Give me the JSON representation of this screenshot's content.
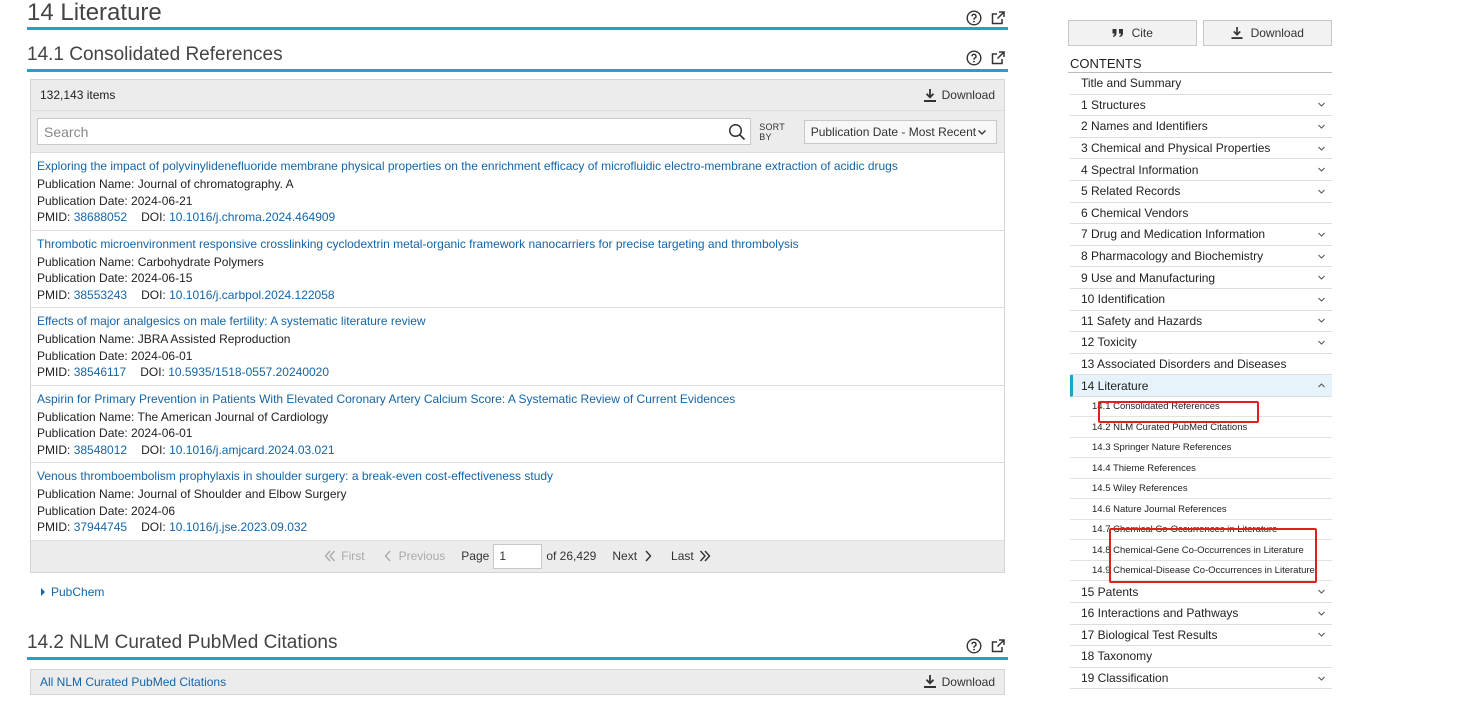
{
  "section": {
    "title": "14 Literature"
  },
  "consolidated": {
    "title": "14.1 Consolidated References",
    "count": "132,143 items",
    "download_label": "Download",
    "search_placeholder": "Search",
    "sort_label": "SORT BY",
    "sort_value": "Publication Date - Most Recent",
    "items": [
      {
        "title": "Exploring the impact of polyvinylidenefluoride membrane physical properties on the enrichment efficacy of microfluidic electro-membrane extraction of acidic drugs",
        "pub_name": "Publication Name: Journal of chromatography. A",
        "pub_date": "Publication Date: 2024-06-21",
        "pmid_label": "PMID:",
        "pmid": "38688052",
        "doi_label": "DOI:",
        "doi": "10.1016/j.chroma.2024.464909"
      },
      {
        "title": "Thrombotic microenvironment responsive crosslinking cyclodextrin metal-organic framework nanocarriers for precise targeting and thrombolysis",
        "pub_name": "Publication Name: Carbohydrate Polymers",
        "pub_date": "Publication Date: 2024-06-15",
        "pmid_label": "PMID:",
        "pmid": "38553243",
        "doi_label": "DOI:",
        "doi": "10.1016/j.carbpol.2024.122058"
      },
      {
        "title": "Effects of major analgesics on male fertility: A systematic literature review",
        "pub_name": "Publication Name: JBRA Assisted Reproduction",
        "pub_date": "Publication Date: 2024-06-01",
        "pmid_label": "PMID:",
        "pmid": "38546117",
        "doi_label": "DOI:",
        "doi": "10.5935/1518-0557.20240020"
      },
      {
        "title": "Aspirin for Primary Prevention in Patients With Elevated Coronary Artery Calcium Score: A Systematic Review of Current Evidences",
        "pub_name": "Publication Name: The American Journal of Cardiology",
        "pub_date": "Publication Date: 2024-06-01",
        "pmid_label": "PMID:",
        "pmid": "38548012",
        "doi_label": "DOI:",
        "doi": "10.1016/j.amjcard.2024.03.021"
      },
      {
        "title": "Venous thromboembolism prophylaxis in shoulder surgery: a break-even cost-effectiveness study",
        "pub_name": "Publication Name: Journal of Shoulder and Elbow Surgery",
        "pub_date": "Publication Date: 2024-06",
        "pmid_label": "PMID:",
        "pmid": "37944745",
        "doi_label": "DOI:",
        "doi": "10.1016/j.jse.2023.09.032"
      }
    ],
    "pager": {
      "first": "First",
      "previous": "Previous",
      "page_label": "Page",
      "page_value": "1",
      "of_total": "of 26,429",
      "next": "Next",
      "last": "Last"
    },
    "source_link": "PubChem"
  },
  "nlm": {
    "title": "14.2 NLM Curated PubMed Citations",
    "all_link": "All NLM Curated PubMed Citations",
    "download_label": "Download"
  },
  "sidebar": {
    "cite_label": "Cite",
    "download_label": "Download",
    "contents_label": "CONTENTS",
    "toc": [
      {
        "label": "Title and Summary",
        "expandable": false
      },
      {
        "label": "1 Structures",
        "expandable": true
      },
      {
        "label": "2 Names and Identifiers",
        "expandable": true
      },
      {
        "label": "3 Chemical and Physical Properties",
        "expandable": true
      },
      {
        "label": "4 Spectral Information",
        "expandable": true
      },
      {
        "label": "5 Related Records",
        "expandable": true
      },
      {
        "label": "6 Chemical Vendors",
        "expandable": false
      },
      {
        "label": "7 Drug and Medication Information",
        "expandable": true
      },
      {
        "label": "8 Pharmacology and Biochemistry",
        "expandable": true
      },
      {
        "label": "9 Use and Manufacturing",
        "expandable": true
      },
      {
        "label": "10 Identification",
        "expandable": true
      },
      {
        "label": "11 Safety and Hazards",
        "expandable": true
      },
      {
        "label": "12 Toxicity",
        "expandable": true
      },
      {
        "label": "13 Associated Disorders and Diseases",
        "expandable": false
      },
      {
        "label": "14 Literature",
        "expandable": true,
        "active": true
      },
      {
        "label": "14.1 Consolidated References",
        "sub": true
      },
      {
        "label": "14.2 NLM Curated PubMed Citations",
        "sub": true
      },
      {
        "label": "14.3 Springer Nature References",
        "sub": true
      },
      {
        "label": "14.4 Thieme References",
        "sub": true
      },
      {
        "label": "14.5 Wiley References",
        "sub": true
      },
      {
        "label": "14.6 Nature Journal References",
        "sub": true
      },
      {
        "label": "14.7 Chemical Co-Occurrences in Literature",
        "sub": true
      },
      {
        "label": "14.8 Chemical-Gene Co-Occurrences in Literature",
        "sub": true
      },
      {
        "label": "14.9 Chemical-Disease Co-Occurrences in Literature",
        "sub": true
      },
      {
        "label": "15 Patents",
        "expandable": true
      },
      {
        "label": "16 Interactions and Pathways",
        "expandable": true
      },
      {
        "label": "17 Biological Test Results",
        "expandable": true
      },
      {
        "label": "18 Taxonomy",
        "expandable": false
      },
      {
        "label": "19 Classification",
        "expandable": true
      }
    ]
  },
  "colors": {
    "accent": "#1fa3c9",
    "link": "#1565a8",
    "highlight_box": "#e02020"
  }
}
